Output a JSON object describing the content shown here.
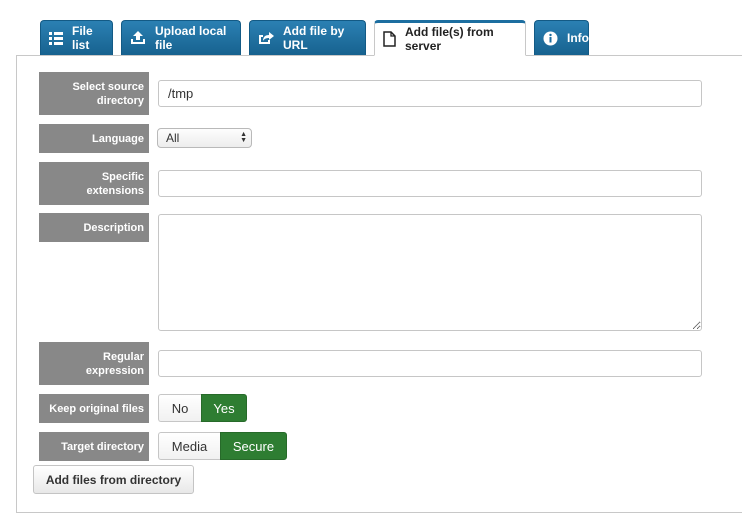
{
  "tabs": [
    {
      "label": "File list",
      "icon": "list-icon"
    },
    {
      "label": "Upload local file",
      "icon": "upload-icon"
    },
    {
      "label": "Add file by URL",
      "icon": "share-icon"
    },
    {
      "label": "Add file(s) from server",
      "icon": "file-icon"
    },
    {
      "label": "Info",
      "icon": "info-icon"
    }
  ],
  "active_tab": "Add file(s) from server",
  "form": {
    "source_label": "Select source directory",
    "source_value": "/tmp",
    "language_label": "Language",
    "language_value": "All",
    "extensions_label": "Specific extensions",
    "extensions_value": "",
    "description_label": "Description",
    "description_value": "",
    "regex_label": "Regular expression",
    "regex_value": "",
    "keep_label": "Keep original files",
    "keep_options": [
      "No",
      "Yes"
    ],
    "keep_selected": "Yes",
    "target_label": "Target directory",
    "target_options": [
      "Media",
      "Secure"
    ],
    "target_selected": "Secure",
    "submit_label": "Add files from directory"
  },
  "colors": {
    "tab_blue": "#1c6ea0",
    "label_gray": "#888888",
    "selected_green": "#2e7d32"
  }
}
